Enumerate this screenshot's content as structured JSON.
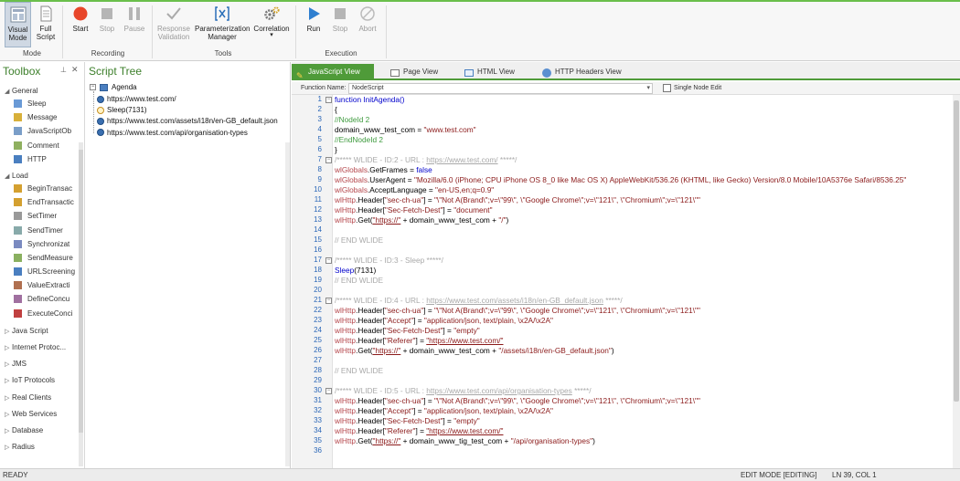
{
  "ribbon": {
    "buttons": {
      "visual_mode": "Visual Mode",
      "full_script": "Full Script",
      "start": "Start",
      "stop_rec": "Stop",
      "pause": "Pause",
      "response_validation": "Response Validation",
      "parameterization_manager": "Parameterization Manager",
      "correlation": "Correlation",
      "run": "Run",
      "stop_exec": "Stop",
      "abort": "Abort"
    },
    "groups": {
      "mode": "Mode",
      "recording": "Recording",
      "tools": "Tools",
      "execution": "Execution"
    }
  },
  "toolbox": {
    "title": "Toolbox",
    "sections": {
      "general": "General",
      "load": "Load"
    },
    "general_items": [
      "Sleep",
      "Message",
      "JavaScriptOb",
      "Comment",
      "HTTP"
    ],
    "load_items": [
      "BeginTransac",
      "EndTransactic",
      "SetTimer",
      "SendTimer",
      "Synchronizat",
      "SendMeasure",
      "URLScreening",
      "ValueExtracti",
      "DefineConcu",
      "ExecuteConci"
    ],
    "collapsed_sections": [
      "Java Script",
      "Internet Protoc...",
      "JMS",
      "IoT Protocols",
      "Real Clients",
      "Web Services",
      "Database",
      "Radius"
    ]
  },
  "script_tree": {
    "title": "Script Tree",
    "root": "Agenda",
    "nodes": [
      "https://www.test.com/",
      "Sleep(7131)",
      "https://www.test.com/assets/i18n/en-GB_default.json",
      "https://www.test.com/api/organisation-types"
    ]
  },
  "editor": {
    "tabs": [
      "JavaScript View",
      "Page View",
      "HTML View",
      "HTTP Headers View"
    ],
    "function_name_label": "Function Name:",
    "function_name_value": "NodeScript",
    "single_node_label": "Single Node Edit",
    "lines": {
      "l1": "function InitAgenda()",
      "l2": "{",
      "l3": "//NodeId 2",
      "l4a": "domain_www_test_com = ",
      "l4b": "\"www.test.com\"",
      "l5": "//EndNodeId 2",
      "l6": "}",
      "l7a": "/***** WLIDE - ID:2 - URL : ",
      "l7b": "https://www.test.com/",
      "l7c": " *****/",
      "l8a": "wlGlobals",
      "l8b": ".GetFrames = ",
      "l8c": "false",
      "l9a": "wlGlobals",
      "l9b": ".UserAgent = ",
      "l9c": "\"Mozilla/6.0 (iPhone; CPU iPhone OS 8_0 like Mac OS X) AppleWebKit/536.26 (KHTML, like Gecko) Version/8.0 Mobile/10A5376e Safari/8536.25\"",
      "l10a": "wlGlobals",
      "l10b": ".AcceptLanguage = ",
      "l10c": "\"en-US,en;q=0.9\"",
      "l11a": "wlHttp",
      "l11b": ".Header[",
      "l11c": "\"sec-ch-ua\"",
      "l11d": "] = ",
      "l11e": "\"\\\"Not A(Brand\\\";v=\\\"99\\\", \\\"Google Chrome\\\";v=\\\"121\\\", \\\"Chromium\\\";v=\\\"121\\\"\"",
      "l12a": "wlHttp",
      "l12b": ".Header[",
      "l12c": "\"Sec-Fetch-Dest\"",
      "l12d": "] = ",
      "l12e": "\"document\"",
      "l13a": "wlHttp",
      "l13b": ".Get(",
      "l13c": "\"https://\"",
      "l13d": " + domain_www_test_com + ",
      "l13e": "\"/\"",
      "l13f": ")",
      "l15": "// END WLIDE",
      "l17": "/***** WLIDE - ID:3 - Sleep *****/",
      "l18a": "Sleep",
      "l18b": "(7131)",
      "l19": "// END WLIDE",
      "l21a": "/***** WLIDE - ID:4 - URL : ",
      "l21b": "https://www.test.com/assets/i18n/en-GB_default.json",
      "l21c": " *****/",
      "l22c": "\"sec-ch-ua\"",
      "l22e": "\"\\\"Not A(Brand\\\";v=\\\"99\\\", \\\"Google Chrome\\\";v=\\\"121\\\", \\\"Chromium\\\";v=\\\"121\\\"\"",
      "l23c": "\"Accept\"",
      "l23e": "\"application/json, text/plain, \\x2A/\\x2A\"",
      "l24c": "\"Sec-Fetch-Dest\"",
      "l24e": "\"empty\"",
      "l25c": "\"Referer\"",
      "l25e": "\"https://www.test.com/\"",
      "l26c": "\"https://\"",
      "l26d": " + domain_www_test_com + ",
      "l26e": "\"/assets/i18n/en-GB_default.json\"",
      "l26f": ")",
      "l28": "// END WLIDE",
      "l30a": "/***** WLIDE - ID:5 - URL : ",
      "l30b": "https://www.test.com/api/organisation-types",
      "l30c": " *****/",
      "l31c": "\"sec-ch-ua\"",
      "l31e": "\"\\\"Not A(Brand\\\";v=\\\"99\\\", \\\"Google Chrome\\\";v=\\\"121\\\", \\\"Chromium\\\";v=\\\"121\\\"\"",
      "l32c": "\"Accept\"",
      "l32e": "\"application/json, text/plain, \\x2A/\\x2A\"",
      "l33c": "\"Sec-Fetch-Dest\"",
      "l33e": "\"empty\"",
      "l34c": "\"Referer\"",
      "l34e": "\"https://www.test.com/\"",
      "l35c": "\"https://\"",
      "l35d": " + domain_www_tig_test_com + ",
      "l35e": "\"/api/organisation-types\"",
      "l35f": ")",
      "wlHttp": "wlHttp",
      "header": ".Header[",
      "eq": "] = ",
      "get": ".Get("
    },
    "line_numbers": [
      "1",
      "2",
      "3",
      "4",
      "5",
      "6",
      "7",
      "8",
      "9",
      "10",
      "11",
      "12",
      "13",
      "14",
      "15",
      "16",
      "17",
      "18",
      "19",
      "20",
      "21",
      "22",
      "23",
      "24",
      "25",
      "26",
      "27",
      "28",
      "29",
      "30",
      "31",
      "32",
      "33",
      "34",
      "35",
      "36"
    ]
  },
  "status": {
    "ready": "READY",
    "mode": "EDIT MODE [EDITING]",
    "position": "LN 39, COL 1"
  },
  "colors": {
    "accent": "#4f9b39",
    "line_number": "#2b67b8"
  }
}
